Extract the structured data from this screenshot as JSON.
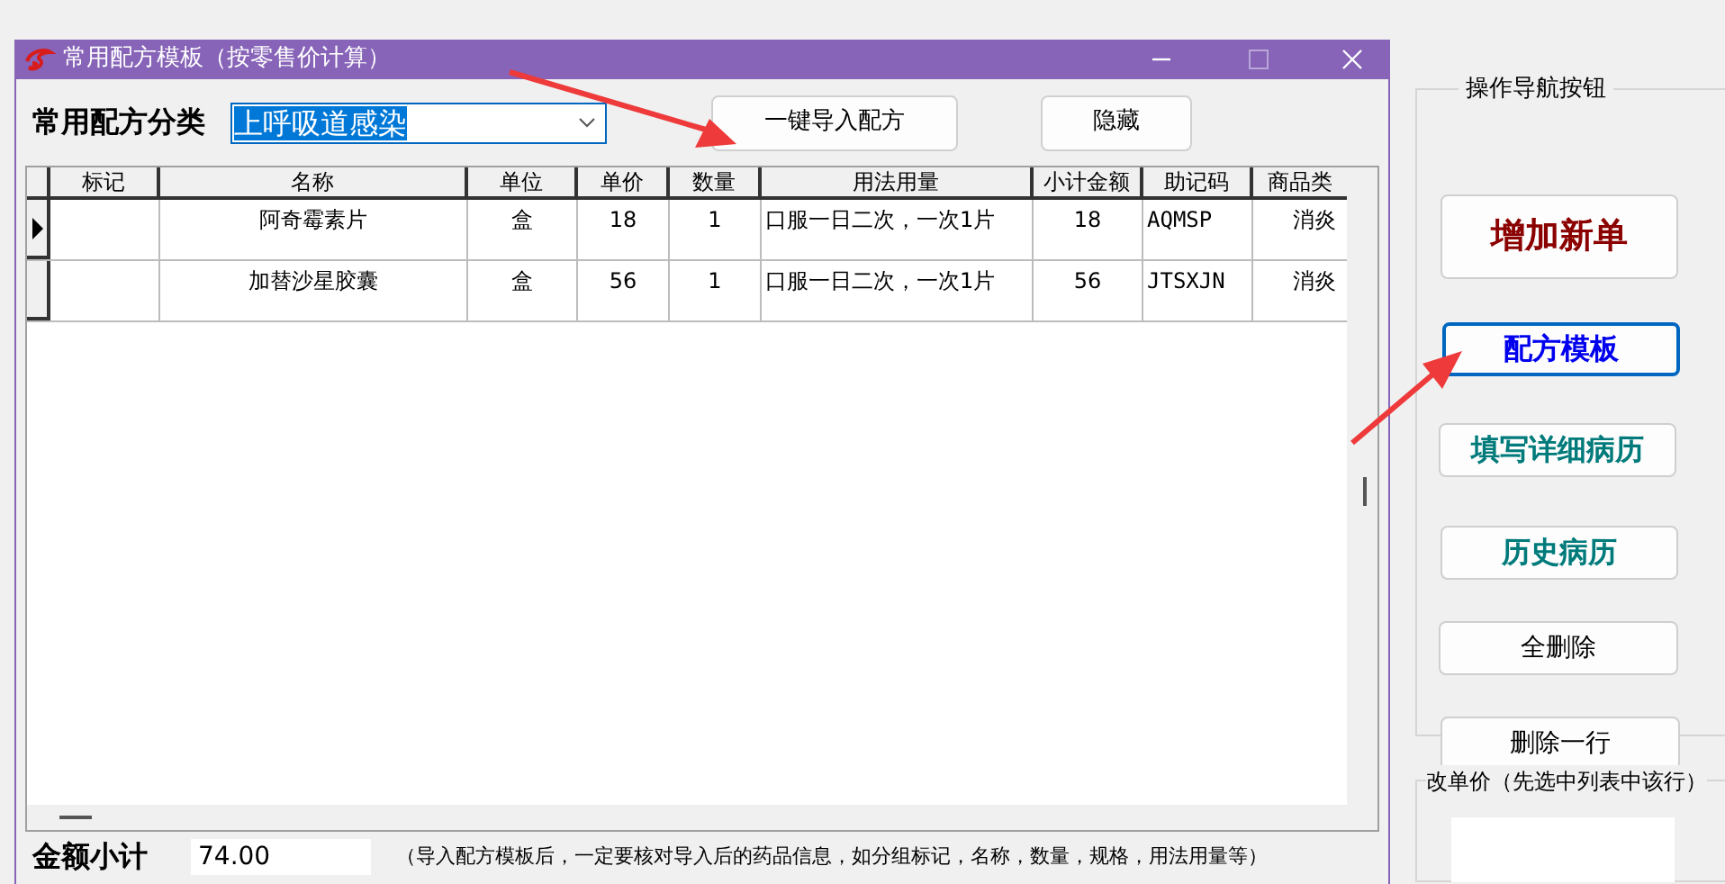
{
  "dialog": {
    "title": "常用配方模板（按零售价计算）",
    "category_label": "常用配方分类",
    "category_value": "上呼吸道感染",
    "buttons": [
      {
        "label": "一键导入配方"
      },
      {
        "label": "隐藏"
      }
    ],
    "table": {
      "columns": [
        "标记",
        "名称",
        "单位",
        "单价",
        "数量",
        "用法用量",
        "小计金额",
        "助记码",
        "商品类"
      ],
      "rows": [
        {
          "selected": true,
          "name": "阿奇霉素片",
          "unit": "盒",
          "price": "18",
          "qty": "1",
          "usage": "口服一日二次，一次1片",
          "subtotal": "18",
          "code": "AQMSP",
          "category": "消炎"
        },
        {
          "selected": false,
          "name": "加替沙星胶囊",
          "unit": "盒",
          "price": "56",
          "qty": "1",
          "usage": "口服一日二次，一次1片",
          "subtotal": "56",
          "code": "JTSXJN",
          "category": "消炎"
        }
      ]
    },
    "total_label": "金额小计",
    "total_value": "74.00",
    "note": "（导入配方模板后，一定要核对导入后的药品信息，如分组标记，名称，数量，规格，用法用量等）"
  },
  "nav": {
    "title": "操作导航按钮",
    "buttons": [
      {
        "label": "增加新单",
        "kind": "headline",
        "selected": false
      },
      {
        "label": "配方模板",
        "kind": "blue",
        "selected": true
      },
      {
        "label": "填写详细病历",
        "kind": "teal",
        "selected": false
      },
      {
        "label": "历史病历",
        "kind": "teal",
        "selected": false
      },
      {
        "label": "全删除",
        "kind": "plain",
        "selected": false
      },
      {
        "label": "删除一行",
        "kind": "plain",
        "selected": false
      }
    ]
  },
  "price_edit": {
    "label": "改单价（先选中列表中该行）"
  }
}
